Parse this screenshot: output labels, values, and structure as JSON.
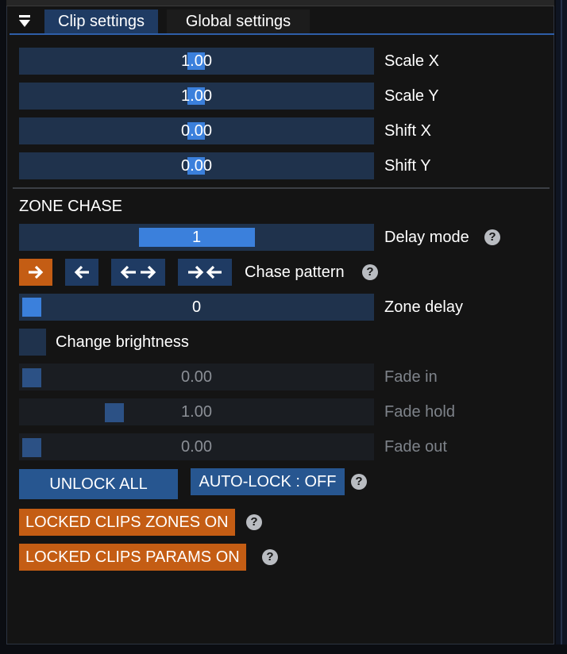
{
  "tabs": {
    "active_label": "Clip settings",
    "inactive_label": "Global settings"
  },
  "transform": {
    "scale_x": {
      "label": "Scale X",
      "value": "1.00"
    },
    "scale_y": {
      "label": "Scale Y",
      "value": "1.00"
    },
    "shift_x": {
      "label": "Shift X",
      "value": "0.00"
    },
    "shift_y": {
      "label": "Shift Y",
      "value": "0.00"
    }
  },
  "zone_chase": {
    "title": "ZONE CHASE",
    "delay_mode": {
      "label": "Delay mode",
      "value": "1"
    },
    "chase_pattern": {
      "label": "Chase pattern",
      "options": [
        {
          "icon": "arrow-right-icon",
          "selected": true
        },
        {
          "icon": "arrow-left-icon",
          "selected": false
        },
        {
          "icon": "arrows-outward-icon",
          "selected": false
        },
        {
          "icon": "arrows-inward-icon",
          "selected": false
        }
      ]
    },
    "zone_delay": {
      "label": "Zone delay",
      "value": "0"
    },
    "change_brightness": {
      "label": "Change brightness",
      "checked": false
    },
    "fade_in": {
      "label": "Fade in",
      "value": "0.00"
    },
    "fade_hold": {
      "label": "Fade hold",
      "value": "1.00"
    },
    "fade_out": {
      "label": "Fade out",
      "value": "0.00"
    }
  },
  "buttons": {
    "unlock_all": "UNLOCK ALL",
    "auto_lock": "AUTO-LOCK : OFF",
    "locked_zones": "LOCKED CLIPS ZONES ON",
    "locked_params": "LOCKED CLIPS PARAMS ON"
  },
  "help_glyph": "?",
  "colors": {
    "accent_blue": "#3b80dc",
    "slider_bg": "#1f324c",
    "orange": "#c45d14",
    "tab_active": "#1f3b63"
  }
}
